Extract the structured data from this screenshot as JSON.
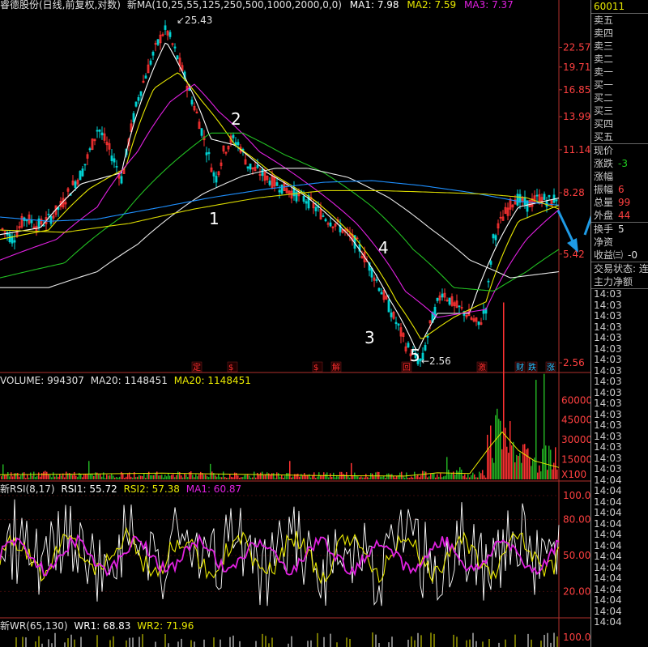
{
  "colors": {
    "bg": "#000000",
    "up": "#ff3232",
    "down": "#00d2d2",
    "grid": "#5a0000",
    "axis": "#b0302c",
    "white": "#ffffff",
    "yellow": "#e8e800",
    "magenta": "#e020e0",
    "green": "#22c022",
    "blue": "#1e90ff",
    "arrow": "#1e9be6"
  },
  "header": {
    "title": "睿德股份(日线,前复权,对数)",
    "ma_name": "新MA(10,25,55,125,250,500,1000,2000,0,0)",
    "ma1": "MA1: 7.98",
    "ma2": "MA2: 7.59",
    "ma3": "MA3: 7.37"
  },
  "volume_header": {
    "name": "VOLUME: 994307",
    "ma20a": "MA20: 1148451",
    "ma20b": "MA20: 1148451"
  },
  "rsi_header": {
    "name": "新RSI(8,17)",
    "rsi1": "RSI1: 55.72",
    "rsi2": "RSI2: 57.38",
    "ma1": "MA1: 60.87"
  },
  "wr_header": {
    "name": "新WR(65,130)",
    "wr1": "WR1: 68.83",
    "wr2": "WR2: 71.96"
  },
  "annotations": {
    "high": "25.43",
    "low": "2.56",
    "wave1": "1",
    "wave2": "2",
    "wave3": "3",
    "wave4": "4",
    "wave5": "5"
  },
  "events": [
    "定",
    "$",
    "$",
    "解",
    "回",
    "激",
    "财",
    "跌",
    "涨"
  ],
  "right_panel": {
    "stock_code": "60011",
    "order_book": [
      "卖五",
      "卖四",
      "卖三",
      "卖二",
      "卖一",
      "买一",
      "买二",
      "买三",
      "买四",
      "买五"
    ],
    "quote_labels": [
      "现价",
      "涨跌",
      "涨幅",
      "振幅",
      "总量",
      "外盘"
    ],
    "quote_values": [
      "",
      "-3",
      "",
      "6",
      "99",
      "44"
    ],
    "extra_labels": [
      "换手",
      "净资",
      "收益㈢"
    ],
    "extra_values": [
      "5",
      "",
      "-0"
    ],
    "trade_status": "交易状态: 连",
    "main_flow": "主力净额",
    "ticks": [
      "14:03",
      "14:03",
      "14:03",
      "14:03",
      "14:03",
      "14:03",
      "14:03",
      "14:03",
      "14:03",
      "14:03",
      "14:03",
      "14:03",
      "14:03",
      "14:03",
      "14:03",
      "14:03",
      "14:03",
      "14:04",
      "14:04",
      "14:04",
      "14:04",
      "14:04",
      "14:04",
      "14:04",
      "14:04",
      "14:04",
      "14:04",
      "14:04",
      "14:04",
      "14:04",
      "14:04"
    ]
  },
  "chart_data": [
    {
      "type": "line",
      "title": "睿德股份(日线,前复权,对数)",
      "scale": "log",
      "yticks": [
        22.57,
        19.71,
        16.85,
        13.99,
        11.14,
        8.28,
        5.42,
        2.56
      ],
      "ylim": [
        2.56,
        28.0
      ],
      "series": [
        {
          "name": "Price",
          "points": [
            [
              0,
              6.5
            ],
            [
              15,
              6.0
            ],
            [
              30,
              7.0
            ],
            [
              45,
              6.6
            ],
            [
              60,
              6.9
            ],
            [
              75,
              7.6
            ],
            [
              90,
              8.8
            ],
            [
              100,
              9.5
            ],
            [
              110,
              11.0
            ],
            [
              120,
              13.0
            ],
            [
              135,
              11.0
            ],
            [
              150,
              9.0
            ],
            [
              160,
              12.5
            ],
            [
              170,
              16.0
            ],
            [
              180,
              19.0
            ],
            [
              190,
              22.0
            ],
            [
              200,
              25.0
            ],
            [
              205,
              25.43
            ],
            [
              215,
              22.0
            ],
            [
              225,
              19.0
            ],
            [
              235,
              16.0
            ],
            [
              245,
              13.5
            ],
            [
              255,
              11.0
            ],
            [
              265,
              9.0
            ],
            [
              275,
              11.0
            ],
            [
              285,
              12.0
            ],
            [
              295,
              11.5
            ],
            [
              305,
              10.0
            ],
            [
              320,
              9.5
            ],
            [
              340,
              8.8
            ],
            [
              360,
              8.3
            ],
            [
              380,
              7.8
            ],
            [
              400,
              7.0
            ],
            [
              420,
              6.5
            ],
            [
              440,
              5.8
            ],
            [
              455,
              5.0
            ],
            [
              470,
              4.2
            ],
            [
              485,
              3.5
            ],
            [
              500,
              2.9
            ],
            [
              512,
              2.65
            ],
            [
              520,
              2.56
            ],
            [
              530,
              3.3
            ],
            [
              545,
              4.2
            ],
            [
              560,
              3.8
            ],
            [
              575,
              3.6
            ],
            [
              590,
              3.3
            ],
            [
              600,
              3.8
            ],
            [
              608,
              6.0
            ],
            [
              620,
              7.0
            ],
            [
              635,
              8.0
            ],
            [
              650,
              7.6
            ],
            [
              665,
              8.0
            ],
            [
              680,
              7.8
            ],
            [
              690,
              8.2
            ]
          ]
        },
        {
          "name": "MA1",
          "points": [
            [
              0,
              6.2
            ],
            [
              50,
              6.5
            ],
            [
              100,
              8.8
            ],
            [
              150,
              9.5
            ],
            [
              180,
              17.0
            ],
            [
              205,
              23.5
            ],
            [
              230,
              18.0
            ],
            [
              260,
              12.0
            ],
            [
              290,
              11.5
            ],
            [
              330,
              9.5
            ],
            [
              380,
              8.0
            ],
            [
              430,
              6.2
            ],
            [
              480,
              4.0
            ],
            [
              515,
              2.75
            ],
            [
              540,
              3.6
            ],
            [
              580,
              3.6
            ],
            [
              605,
              5.2
            ],
            [
              640,
              7.5
            ],
            [
              690,
              7.98
            ]
          ]
        },
        {
          "name": "MA2",
          "points": [
            [
              0,
              6.0
            ],
            [
              60,
              6.4
            ],
            [
              110,
              8.5
            ],
            [
              155,
              9.8
            ],
            [
              190,
              17.0
            ],
            [
              220,
              19.0
            ],
            [
              250,
              15.5
            ],
            [
              290,
              11.5
            ],
            [
              340,
              9.3
            ],
            [
              390,
              7.8
            ],
            [
              440,
              6.0
            ],
            [
              490,
              3.9
            ],
            [
              520,
              3.0
            ],
            [
              560,
              3.5
            ],
            [
              600,
              3.9
            ],
            [
              640,
              6.8
            ],
            [
              690,
              7.59
            ]
          ]
        },
        {
          "name": "MA3",
          "points": [
            [
              0,
              5.2
            ],
            [
              70,
              6.0
            ],
            [
              120,
              7.5
            ],
            [
              170,
              11.0
            ],
            [
              210,
              15.5
            ],
            [
              240,
              17.5
            ],
            [
              270,
              14.5
            ],
            [
              320,
              11.0
            ],
            [
              380,
              8.8
            ],
            [
              440,
              6.7
            ],
            [
              500,
              4.2
            ],
            [
              540,
              3.5
            ],
            [
              600,
              3.7
            ],
            [
              650,
              6.0
            ],
            [
              690,
              7.37
            ]
          ]
        },
        {
          "name": "MA4",
          "points": [
            [
              0,
              4.6
            ],
            [
              80,
              5.1
            ],
            [
              150,
              7.0
            ],
            [
              210,
              10.0
            ],
            [
              260,
              12.5
            ],
            [
              300,
              12.5
            ],
            [
              350,
              10.8
            ],
            [
              400,
              9.5
            ],
            [
              460,
              7.5
            ],
            [
              510,
              5.6
            ],
            [
              560,
              4.3
            ],
            [
              610,
              4.2
            ],
            [
              650,
              4.8
            ],
            [
              690,
              5.6
            ]
          ]
        },
        {
          "name": "MA5",
          "points": [
            [
              0,
              4.3
            ],
            [
              60,
              4.3
            ],
            [
              120,
              4.8
            ],
            [
              170,
              5.8
            ],
            [
              210,
              7.0
            ],
            [
              250,
              8.2
            ],
            [
              300,
              9.3
            ],
            [
              340,
              9.8
            ],
            [
              380,
              9.8
            ],
            [
              430,
              9.2
            ],
            [
              480,
              8.0
            ],
            [
              530,
              6.5
            ],
            [
              580,
              5.2
            ],
            [
              630,
              4.6
            ],
            [
              690,
              4.8
            ]
          ]
        },
        {
          "name": "MA6",
          "points": [
            [
              0,
              7.0
            ],
            [
              60,
              6.8
            ],
            [
              120,
              6.9
            ],
            [
              200,
              7.5
            ],
            [
              260,
              8.0
            ],
            [
              330,
              8.5
            ],
            [
              400,
              8.9
            ],
            [
              460,
              9.0
            ],
            [
              520,
              8.7
            ],
            [
              580,
              8.3
            ],
            [
              640,
              7.8
            ],
            [
              690,
              7.6
            ]
          ]
        },
        {
          "name": "MA7",
          "points": [
            [
              0,
              6.4
            ],
            [
              80,
              6.3
            ],
            [
              160,
              6.7
            ],
            [
              240,
              7.4
            ],
            [
              320,
              8.0
            ],
            [
              400,
              8.4
            ],
            [
              470,
              8.4
            ],
            [
              540,
              8.3
            ],
            [
              600,
              8.2
            ],
            [
              650,
              8.0
            ],
            [
              690,
              7.4
            ]
          ]
        }
      ]
    },
    {
      "type": "bar",
      "title": "VOLUME",
      "yticks": [
        60000,
        45000,
        30000,
        15000
      ],
      "ylim": [
        0,
        70000
      ],
      "unit": "X100",
      "segments": [
        {
          "x0": 0,
          "x1": 520,
          "base": 3500
        },
        {
          "x0": 520,
          "x1": 600,
          "base": 4500
        },
        {
          "x0": 600,
          "x1": 635,
          "base": 32000
        },
        {
          "x0": 635,
          "x1": 690,
          "base": 16000
        }
      ],
      "ma20": [
        [
          0,
          3500
        ],
        [
          100,
          4000
        ],
        [
          160,
          4500
        ],
        [
          200,
          4800
        ],
        [
          300,
          3800
        ],
        [
          400,
          2800
        ],
        [
          500,
          2500
        ],
        [
          540,
          5000
        ],
        [
          580,
          4500
        ],
        [
          605,
          25000
        ],
        [
          620,
          36000
        ],
        [
          640,
          22000
        ],
        [
          660,
          14000
        ],
        [
          690,
          9000
        ]
      ]
    },
    {
      "type": "line",
      "title": "新RSI(8,17)",
      "yticks": [
        100.0,
        80.0,
        50.0,
        20.0
      ],
      "ylim": [
        0,
        100
      ],
      "series": [
        {
          "name": "RSI1",
          "value": 55.72
        },
        {
          "name": "RSI2",
          "value": 57.38
        },
        {
          "name": "MA1",
          "value": 60.87
        }
      ]
    },
    {
      "type": "line",
      "title": "新WR(65,130)",
      "yticks": [
        100.0
      ],
      "series": [
        {
          "name": "WR1",
          "value": 68.83
        },
        {
          "name": "WR2",
          "value": 71.96
        }
      ]
    }
  ]
}
